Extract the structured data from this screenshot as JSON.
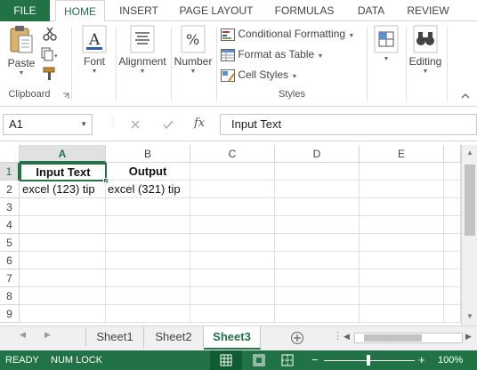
{
  "ribbon_tabs": [
    "FILE",
    "HOME",
    "INSERT",
    "PAGE LAYOUT",
    "FORMULAS",
    "DATA",
    "REVIEW"
  ],
  "active_tab": "HOME",
  "clipboard": {
    "paste_label": "Paste",
    "group_label": "Clipboard"
  },
  "font": {
    "label": "Font"
  },
  "alignment": {
    "label": "Alignment"
  },
  "number": {
    "label": "Number"
  },
  "styles": {
    "conditional_formatting": "Conditional Formatting",
    "format_as_table": "Format as Table",
    "cell_styles": "Cell Styles",
    "group_label": "Styles"
  },
  "cells": {
    "A1": "Input Text",
    "B1": "Output",
    "A2": "excel (123) tip",
    "B2": "excel (321) tip"
  },
  "editing": {
    "label": "Editing"
  },
  "formula_bar": {
    "name_box": "A1",
    "formula": "Input Text"
  },
  "columns": [
    "A",
    "B",
    "C",
    "D",
    "E"
  ],
  "rows": [
    "1",
    "2",
    "3",
    "4",
    "5",
    "6",
    "7",
    "8",
    "9"
  ],
  "sheets": [
    "Sheet1",
    "Sheet2",
    "Sheet3"
  ],
  "active_sheet": "Sheet3",
  "status": {
    "ready": "READY",
    "num_lock": "NUM LOCK",
    "zoom": "100%"
  },
  "colors": {
    "accent": "#217346",
    "header_selected": "#e1e1e1"
  },
  "icons": [
    "paste-icon",
    "cut-icon",
    "copy-icon",
    "format-painter-icon",
    "font-icon",
    "alignment-icon",
    "percent-icon",
    "conditional-formatting-icon",
    "format-as-table-icon",
    "cell-styles-icon",
    "cells-icon",
    "editing-icon",
    "cancel-icon",
    "enter-icon",
    "fx-icon",
    "new-sheet-icon",
    "normal-view-icon",
    "page-layout-view-icon",
    "page-break-view-icon"
  ]
}
